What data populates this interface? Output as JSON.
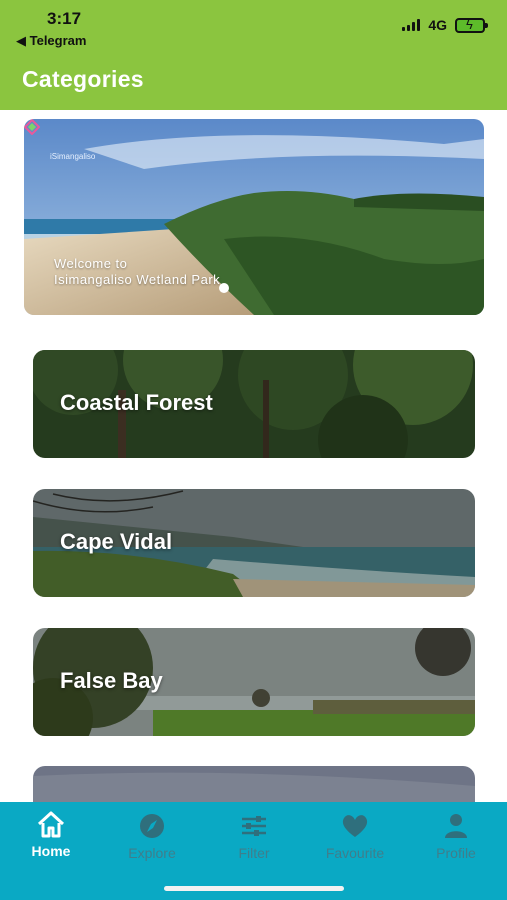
{
  "status_bar": {
    "time": "3:17",
    "back_app": "◀ Telegram",
    "network": "4G"
  },
  "header": {
    "title": "Categories"
  },
  "hero": {
    "logo_text": "iSimangaliso",
    "caption_line1": "Welcome to",
    "caption_line2": "Isimangaliso Wetland Park"
  },
  "categories": [
    {
      "label": "Coastal Forest"
    },
    {
      "label": "Cape Vidal"
    },
    {
      "label": "False Bay"
    },
    {
      "label": ""
    }
  ],
  "tabs": [
    {
      "label": "Home",
      "icon": "home-icon",
      "active": true
    },
    {
      "label": "Explore",
      "icon": "compass-icon",
      "active": false
    },
    {
      "label": "Filter",
      "icon": "sliders-icon",
      "active": false
    },
    {
      "label": "Favourite",
      "icon": "heart-icon",
      "active": false
    },
    {
      "label": "Profile",
      "icon": "user-icon",
      "active": false
    }
  ],
  "colors": {
    "header": "#8bc53f",
    "tabbar": "#0aa9c4",
    "tab_active": "#ffffff",
    "tab_inactive": "#3f7e8c"
  }
}
